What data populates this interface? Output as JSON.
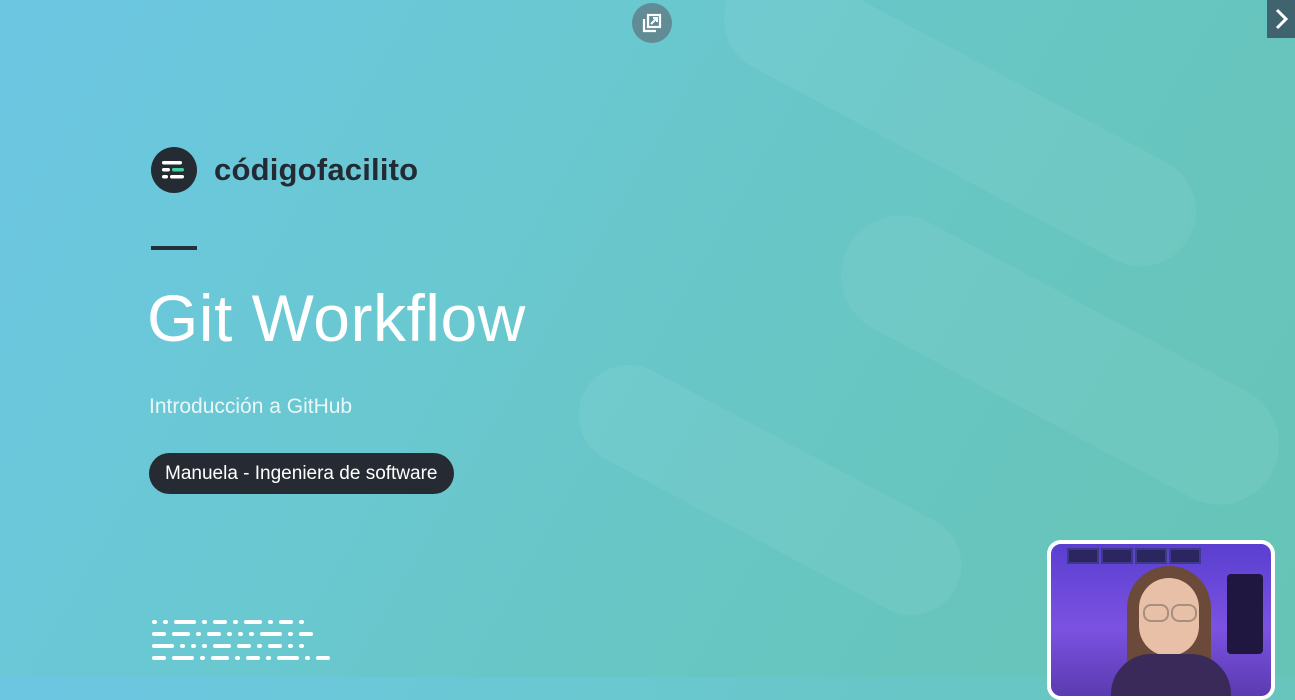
{
  "brand": {
    "name": "códigofacilito"
  },
  "slide": {
    "title": "Git Workflow",
    "subtitle": "Introducción a GitHub",
    "presenter_badge": "Manuela - Ingeniera de software"
  },
  "controls": {
    "popout_icon": "picture-in-picture-icon",
    "next_icon": "chevron-right-icon"
  },
  "colors": {
    "background": "#6ac8d0",
    "brand_dark": "#242a33",
    "title_text": "#ffffff"
  }
}
